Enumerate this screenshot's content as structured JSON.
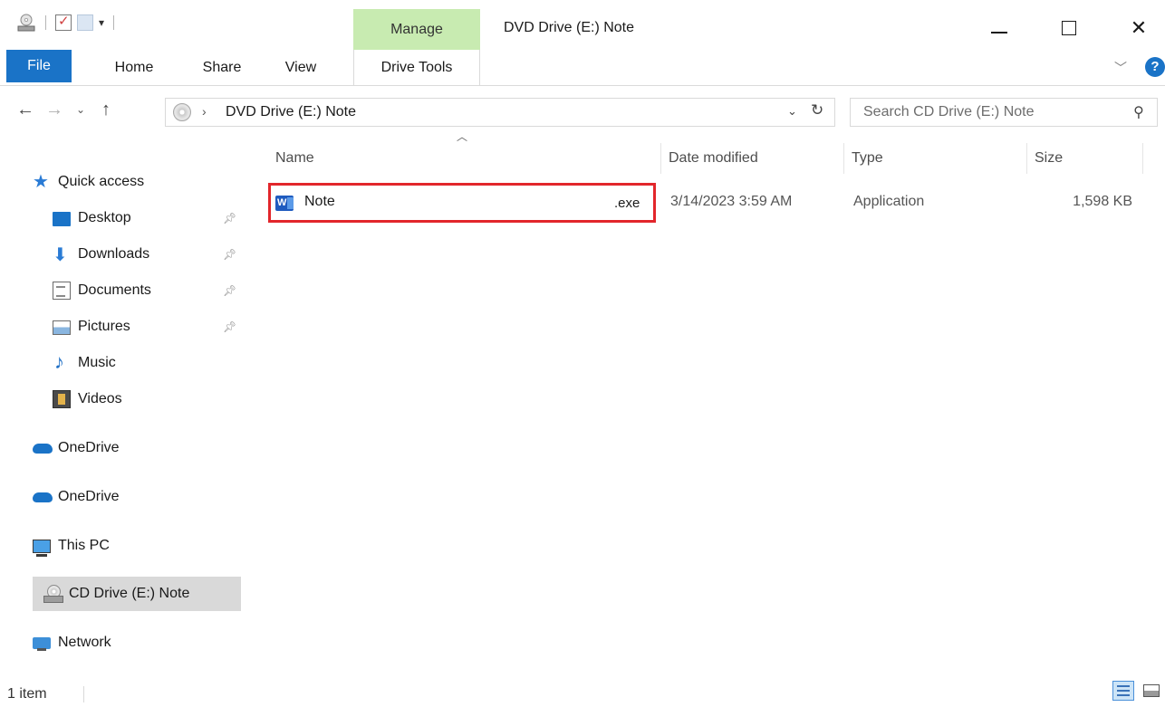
{
  "window": {
    "title": "DVD Drive (E:) Note",
    "contextual_tab_group": "Manage"
  },
  "quick_access_toolbar": {
    "dropdown_glyph": "▾"
  },
  "ribbon": {
    "tabs": [
      {
        "label": "File"
      },
      {
        "label": "Home"
      },
      {
        "label": "Share"
      },
      {
        "label": "View"
      },
      {
        "label": "Drive Tools"
      }
    ],
    "help_glyph": "?"
  },
  "address_bar": {
    "path": "DVD Drive (E:) Note",
    "separator": "›"
  },
  "search": {
    "placeholder": "Search CD Drive (E:) Note"
  },
  "navigation_pane": {
    "quick_access": "Quick access",
    "items": [
      {
        "label": "Desktop",
        "icon": "desktop-icon"
      },
      {
        "label": "Downloads",
        "icon": "downloads-icon"
      },
      {
        "label": "Documents",
        "icon": "documents-icon"
      },
      {
        "label": "Pictures",
        "icon": "pictures-icon"
      },
      {
        "label": "Music",
        "icon": "music-icon"
      },
      {
        "label": "Videos",
        "icon": "videos-icon"
      }
    ],
    "onedrive_1": "OneDrive",
    "onedrive_2": "OneDrive",
    "this_pc": "This PC",
    "cd_drive": "CD Drive (E:) Note",
    "network": "Network"
  },
  "file_list": {
    "columns": {
      "name": "Name",
      "date": "Date modified",
      "type": "Type",
      "size": "Size"
    },
    "rows": [
      {
        "name": "Note",
        "extension": ".exe",
        "date_modified": "3/14/2023 3:59 AM",
        "type": "Application",
        "size": "1,598 KB",
        "icon": "word-document-icon"
      }
    ]
  },
  "status_bar": {
    "item_count": "1 item"
  },
  "colors": {
    "accent": "#1a73c7",
    "manage_tab": "#c8ebb1",
    "highlight_border": "#e2262b",
    "selected_nav": "#d9d9d9"
  }
}
